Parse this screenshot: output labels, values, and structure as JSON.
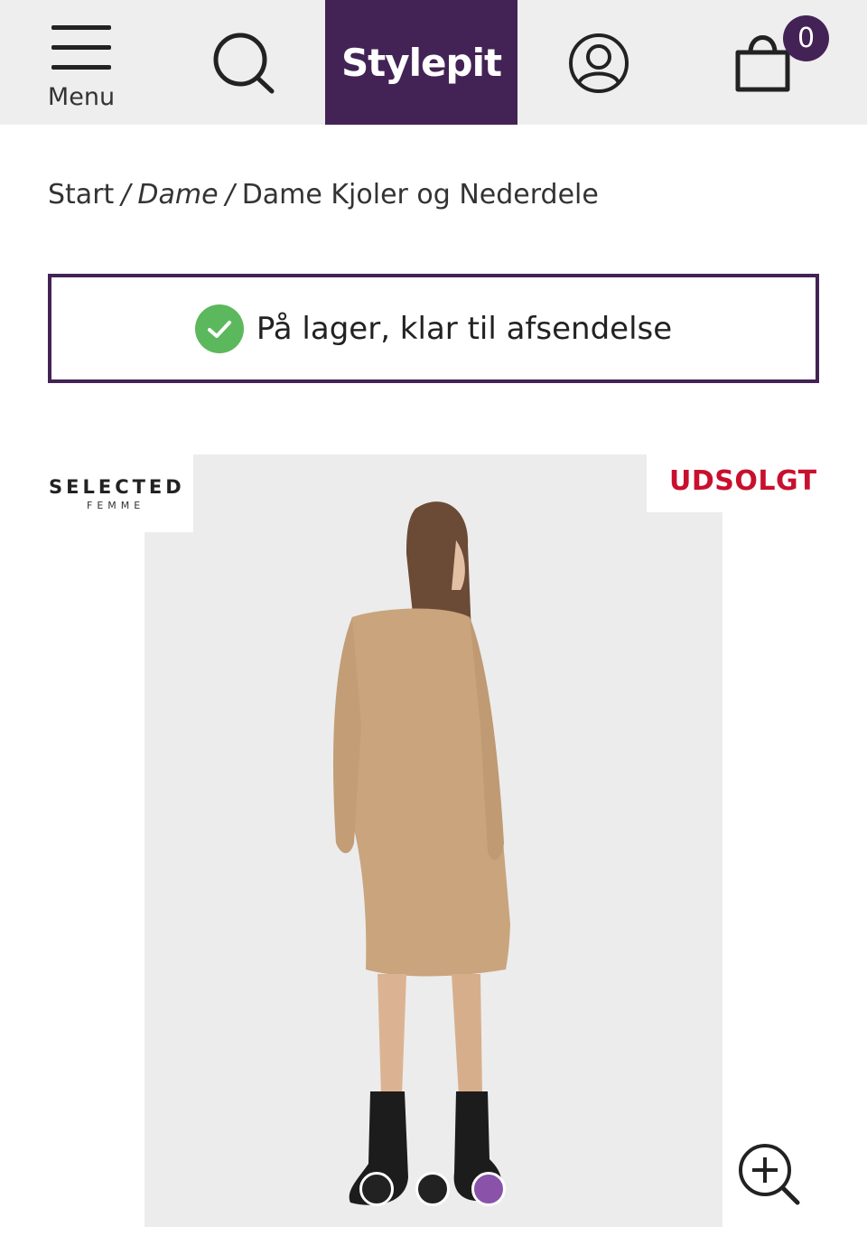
{
  "header": {
    "menu_label": "Menu",
    "logo_text": "Stylepit",
    "cart_count": "0"
  },
  "breadcrumb": {
    "items": [
      "Start",
      "Dame",
      "Dame Kjoler og Nederdele"
    ],
    "separator": "/"
  },
  "stock": {
    "text": "På lager, klar til afsendelse"
  },
  "product": {
    "brand_line1": "SELECTED",
    "brand_line2": "FEMME",
    "badge": "UDSOLGT",
    "color_dots": [
      "#222222",
      "#222222",
      "#8a52a8"
    ]
  },
  "colors": {
    "brand_purple": "#432355",
    "header_bg": "#eeeeee",
    "soldout_red": "#c8102e",
    "success_green": "#5cb85c"
  }
}
